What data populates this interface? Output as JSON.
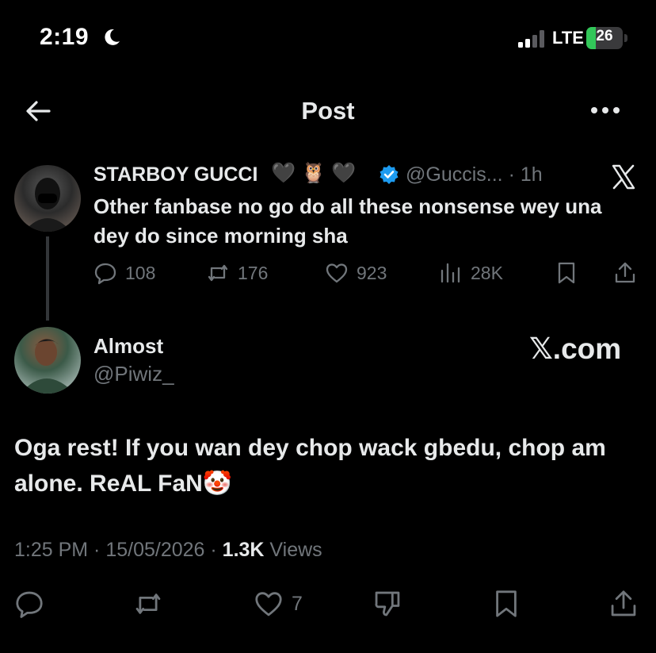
{
  "status_bar": {
    "time": "2:19",
    "network": "LTE",
    "battery": "26",
    "battery_level": 0.26
  },
  "header": {
    "title": "Post"
  },
  "quoted_post": {
    "author_name": "STARBOY GUCCI",
    "author_emojis": "🖤 🦉 🖤",
    "handle_time": "@Guccis... · 1h",
    "text": "Other fanbase no go do all these nonsense wey una dey do since morning sha",
    "replies": "108",
    "reposts": "176",
    "likes": "923",
    "views": "28K"
  },
  "main_post": {
    "author_name": "Almost",
    "handle": "@Piwiz_",
    "watermark": "𝕏.com",
    "text": "Oga rest! If you wan dey chop wack gbedu, chop am alone. ReAL FaN🤡",
    "meta_time": "1:25 PM · 15/05/2026 · ",
    "meta_views_count": "1.3K",
    "meta_views_label": " Views",
    "likes": "7"
  },
  "colors": {
    "background": "#000000",
    "text": "#e7e9ea",
    "muted": "#71767b",
    "verified": "#1d9bf0",
    "battery": "#32c759"
  }
}
